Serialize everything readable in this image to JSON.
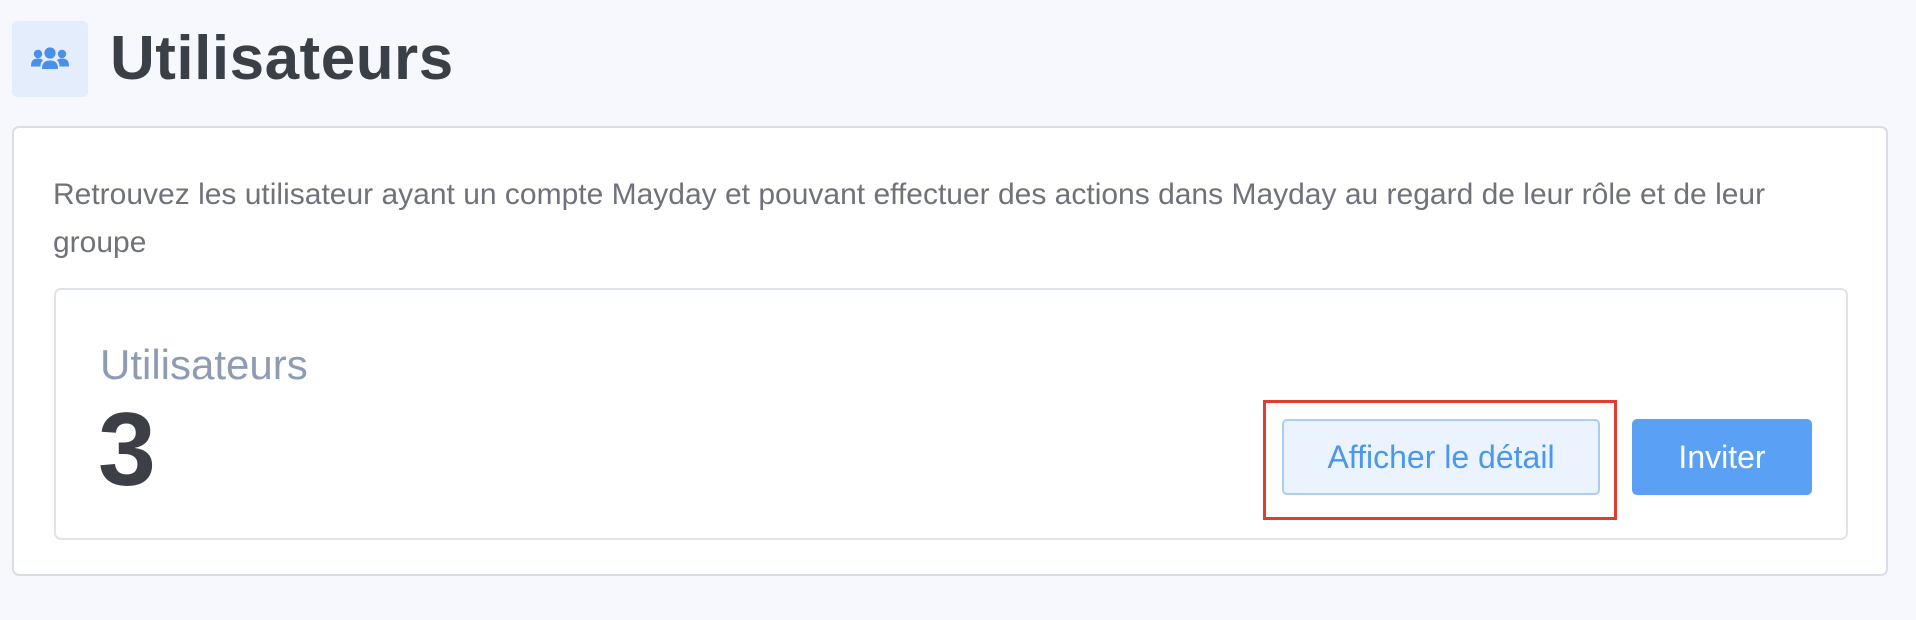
{
  "header": {
    "icon": "users-icon",
    "title": "Utilisateurs"
  },
  "card": {
    "description": "Retrouvez les utilisateur ayant un compte Mayday et pouvant effectuer des actions dans Mayday au regard de leur rôle et de leur groupe",
    "stats": {
      "label": "Utilisateurs",
      "count": "3"
    },
    "actions": {
      "details_label": "Afficher le détail",
      "invite_label": "Inviter"
    }
  },
  "colors": {
    "background": "#f6f8fd",
    "accent": "#5aa0f4",
    "highlight": "#dd3f2d"
  }
}
